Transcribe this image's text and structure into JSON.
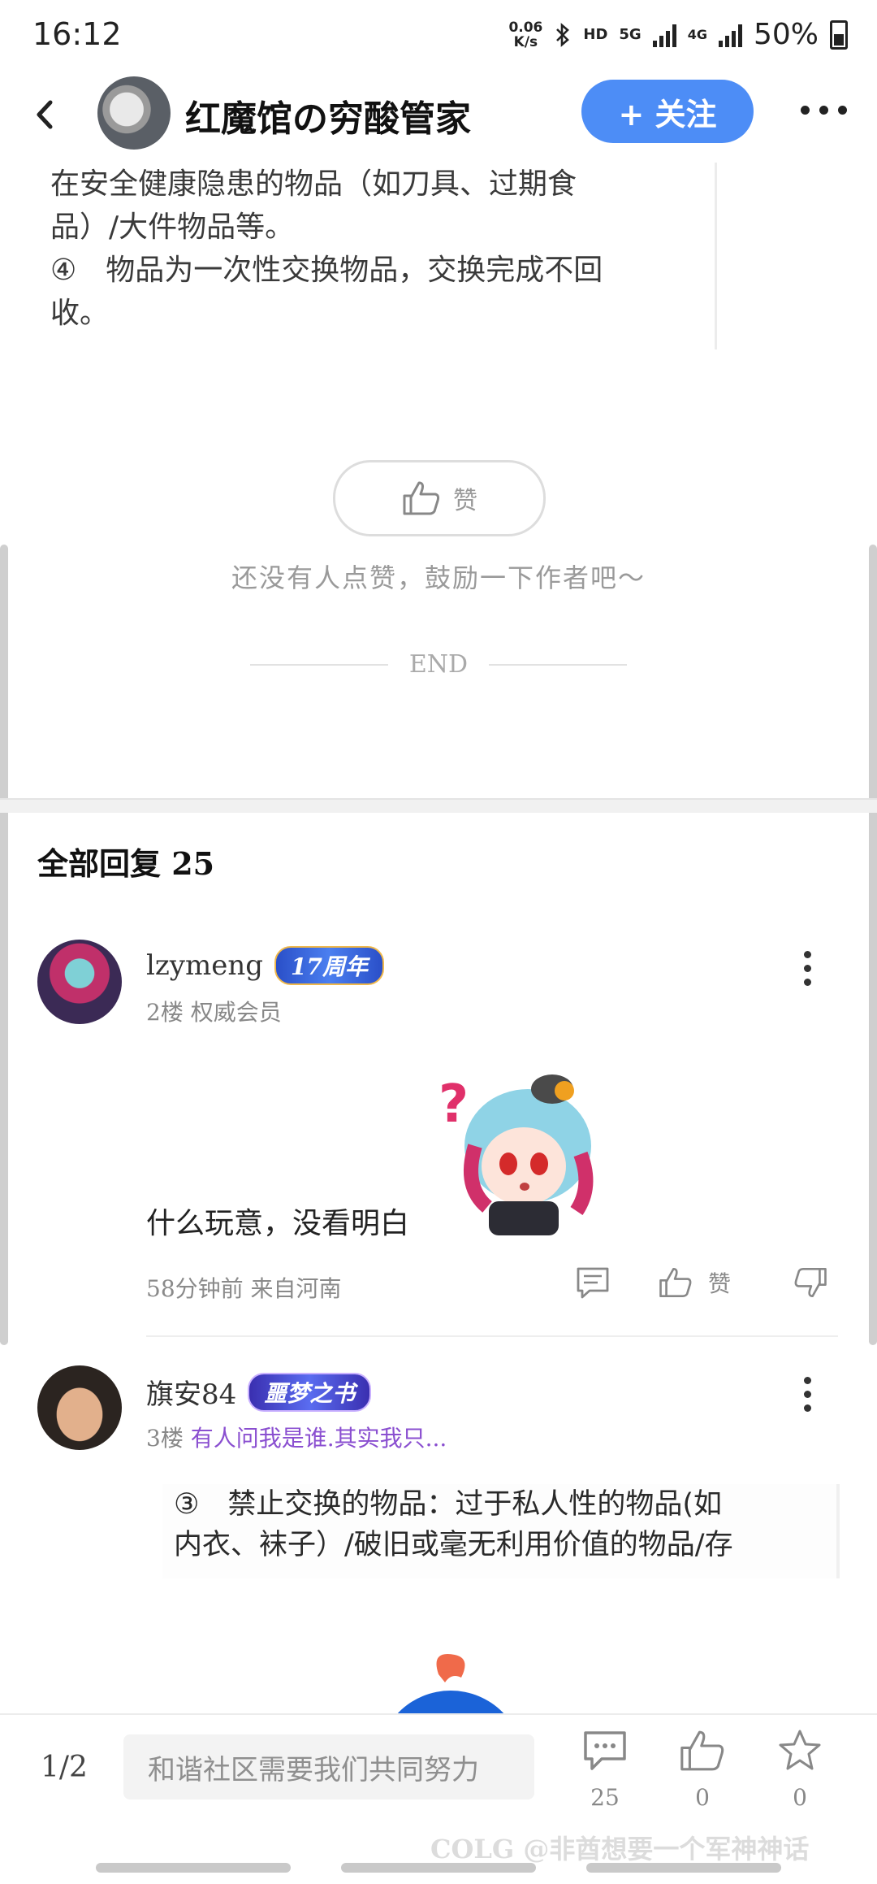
{
  "status_bar": {
    "time": "16:12",
    "net_speed_value": "0.06",
    "net_speed_unit": "K/s",
    "hd": "HD",
    "net1": "5G",
    "net2": "4G",
    "battery": "50%"
  },
  "header": {
    "title": "红魔馆の穷酸管家",
    "follow_label": "+ 关注"
  },
  "post": {
    "lines": [
      "在安全健康隐患的物品（如刀具、过期食",
      "品）/大件物品等。",
      "④　物品为一次性交换物品，交换完成不回",
      "收。"
    ],
    "like_label": "赞",
    "like_hint": "还没有人点赞，鼓励一下作者吧～",
    "end_label": "END"
  },
  "replies": {
    "title": "全部回复 25",
    "items": [
      {
        "username": "lzymeng",
        "badge": "17周年",
        "meta_floor": "2楼",
        "meta_role": "权威会员",
        "text": "什么玩意，没看明白",
        "time_location": "58分钟前 来自河南",
        "like_label": "赞"
      },
      {
        "username": "旗安84",
        "badge": "噩梦之书",
        "meta_floor": "3楼",
        "meta_signature": "有人问我是谁.其实我只...",
        "quote_lines": [
          "③　禁止交换的物品：过于私人性的物品(如",
          "内衣、袜子）/破旧或毫无利用价值的物品/存"
        ]
      }
    ]
  },
  "bottom_bar": {
    "page_indicator": "1/2",
    "input_placeholder": "和谐社区需要我们共同努力",
    "comment_count": "25",
    "like_count": "0",
    "star_count": "0",
    "watermark": "COLG @非酋想要一个军神神话"
  },
  "colors": {
    "accent": "#4d8df6",
    "badge_17": "#3a6fe0",
    "badge_book": "#5a4fe0",
    "signature": "#8a4fd0"
  }
}
